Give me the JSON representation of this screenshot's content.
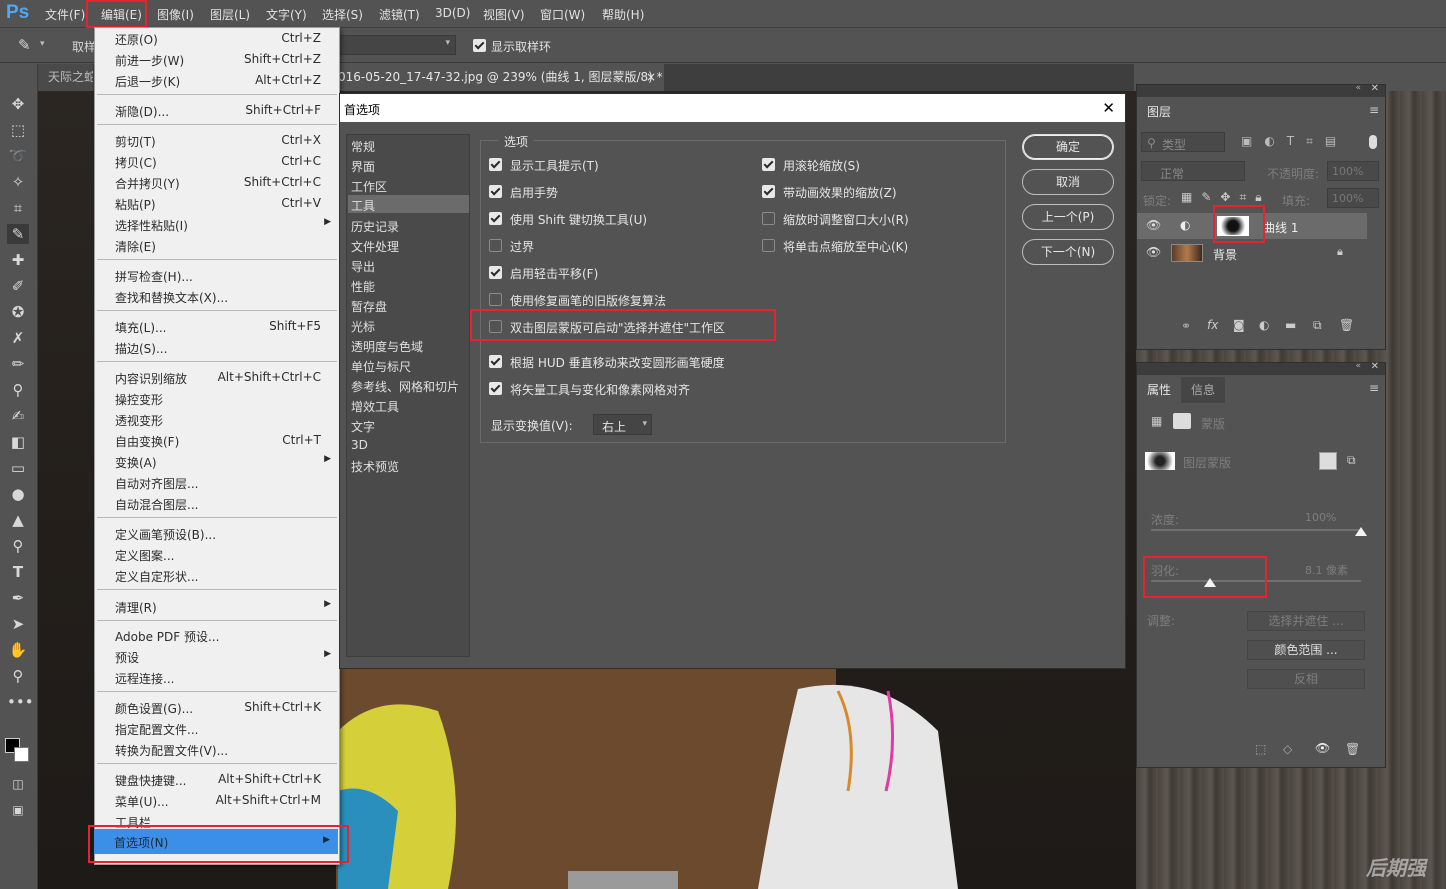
{
  "app": {
    "logo": "Ps"
  },
  "menubar": {
    "items": [
      "文件(F)",
      "编辑(E)",
      "图像(I)",
      "图层(L)",
      "文字(Y)",
      "选择(S)",
      "滤镜(T)",
      "3D(D)",
      "视图(V)",
      "窗口(W)",
      "帮助(H)"
    ]
  },
  "optionsbar": {
    "sample_label": "取样",
    "show_ring_label": "显示取样环"
  },
  "tabs": [
    {
      "label": "天际之蛇"
    },
    {
      "label": "016-05-20_17-47-32.jpg @ 239% (曲线 1, 图层蒙版/8) *",
      "close": "×"
    }
  ],
  "edit_menu": {
    "items": [
      {
        "label": "还原(O)",
        "shortcut": "Ctrl+Z"
      },
      {
        "label": "前进一步(W)",
        "shortcut": "Shift+Ctrl+Z"
      },
      {
        "label": "后退一步(K)",
        "shortcut": "Alt+Ctrl+Z"
      },
      {
        "label": "渐隐(D)...",
        "shortcut": "Shift+Ctrl+F"
      },
      {
        "label": "剪切(T)",
        "shortcut": "Ctrl+X"
      },
      {
        "label": "拷贝(C)",
        "shortcut": "Ctrl+C"
      },
      {
        "label": "合并拷贝(Y)",
        "shortcut": "Shift+Ctrl+C"
      },
      {
        "label": "粘贴(P)",
        "shortcut": "Ctrl+V"
      },
      {
        "label": "选择性粘贴(I)",
        "shortcut": "",
        "submenu": true
      },
      {
        "label": "清除(E)",
        "shortcut": ""
      },
      {
        "label": "拼写检查(H)...",
        "shortcut": ""
      },
      {
        "label": "查找和替换文本(X)...",
        "shortcut": ""
      },
      {
        "label": "填充(L)...",
        "shortcut": "Shift+F5"
      },
      {
        "label": "描边(S)...",
        "shortcut": ""
      },
      {
        "label": "内容识别缩放",
        "shortcut": "Alt+Shift+Ctrl+C"
      },
      {
        "label": "操控变形",
        "shortcut": ""
      },
      {
        "label": "透视变形",
        "shortcut": ""
      },
      {
        "label": "自由变换(F)",
        "shortcut": "Ctrl+T"
      },
      {
        "label": "变换(A)",
        "shortcut": "",
        "submenu": true
      },
      {
        "label": "自动对齐图层...",
        "shortcut": ""
      },
      {
        "label": "自动混合图层...",
        "shortcut": ""
      },
      {
        "label": "定义画笔预设(B)...",
        "shortcut": ""
      },
      {
        "label": "定义图案...",
        "shortcut": ""
      },
      {
        "label": "定义自定形状...",
        "shortcut": ""
      },
      {
        "label": "清理(R)",
        "shortcut": "",
        "submenu": true
      },
      {
        "label": "Adobe PDF 预设...",
        "shortcut": ""
      },
      {
        "label": "预设",
        "shortcut": "",
        "submenu": true
      },
      {
        "label": "远程连接...",
        "shortcut": ""
      },
      {
        "label": "颜色设置(G)...",
        "shortcut": "Shift+Ctrl+K"
      },
      {
        "label": "指定配置文件...",
        "shortcut": ""
      },
      {
        "label": "转换为配置文件(V)...",
        "shortcut": ""
      },
      {
        "label": "键盘快捷键...",
        "shortcut": "Alt+Shift+Ctrl+K"
      },
      {
        "label": "菜单(U)...",
        "shortcut": "Alt+Shift+Ctrl+M"
      },
      {
        "label": "工具栏...",
        "shortcut": ""
      },
      {
        "label": "首选项(N)",
        "shortcut": "",
        "submenu": true
      }
    ]
  },
  "dialog": {
    "title": "首选项",
    "close": "✕",
    "sidebar": [
      "常规",
      "界面",
      "工作区",
      "工具",
      "历史记录",
      "文件处理",
      "导出",
      "性能",
      "暂存盘",
      "光标",
      "透明度与色域",
      "单位与标尺",
      "参考线、网格和切片",
      "增效工具",
      "文字",
      "3D",
      "技术预览"
    ],
    "group_title": "选项",
    "left_options": [
      {
        "label": "显示工具提示(T)",
        "checked": true
      },
      {
        "label": "启用手势",
        "checked": true
      },
      {
        "label": "使用 Shift 键切换工具(U)",
        "checked": true
      },
      {
        "label": "过界",
        "checked": false
      },
      {
        "label": "启用轻击平移(F)",
        "checked": true
      },
      {
        "label": "使用修复画笔的旧版修复算法",
        "checked": false
      },
      {
        "label": "双击图层蒙版可启动\"选择并遮住\"工作区",
        "checked": false
      },
      {
        "label": "根据 HUD 垂直移动来改变圆形画笔硬度",
        "checked": true
      },
      {
        "label": "将矢量工具与变化和像素网格对齐",
        "checked": true
      }
    ],
    "right_options": [
      {
        "label": "用滚轮缩放(S)",
        "checked": true
      },
      {
        "label": "带动画效果的缩放(Z)",
        "checked": true
      },
      {
        "label": "缩放时调整窗口大小(R)",
        "checked": false
      },
      {
        "label": "将单击点缩放至中心(K)",
        "checked": false
      }
    ],
    "transform_label": "显示变换值(V):",
    "transform_value": "右上",
    "buttons": {
      "ok": "确定",
      "cancel": "取消",
      "prev": "上一个(P)",
      "next": "下一个(N)"
    }
  },
  "layers_panel": {
    "tab": "图层",
    "filter_label": "类型",
    "blend_mode": "正常",
    "opacity_label": "不透明度:",
    "opacity_value": "100%",
    "lock_label": "锁定:",
    "fill_label": "填充:",
    "fill_value": "100%",
    "layers": [
      {
        "name": "曲线 1"
      },
      {
        "name": "背景"
      }
    ],
    "footer_fx": "fx"
  },
  "properties_panel": {
    "tabs": [
      "属性",
      "信息"
    ],
    "mask_section": "蒙版",
    "layer_mask_label": "图层蒙版",
    "density_label": "浓度:",
    "density_value": "100%",
    "density_fraction": 1.0,
    "feather_label": "羽化:",
    "feather_value": "8.1 像素",
    "feather_fraction": 0.28,
    "adjust_label": "调整:",
    "btn_select_mask": "选择并遮住 ...",
    "btn_color_range": "颜色范围 ...",
    "btn_invert": "反相"
  },
  "watermark": "后期强"
}
